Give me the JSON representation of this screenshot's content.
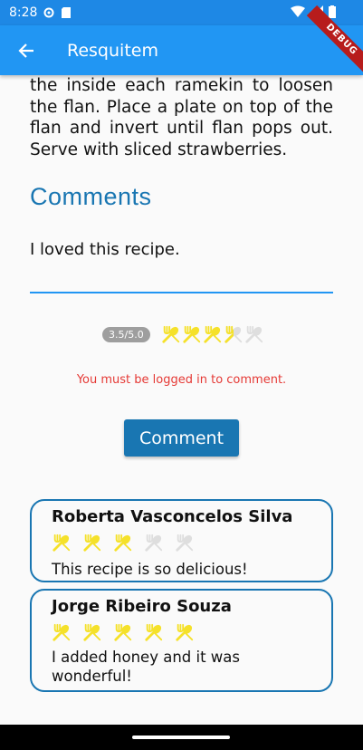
{
  "status_bar": {
    "time": "8:28",
    "icons": [
      "settings-icon",
      "sd-card-icon",
      "wifi-icon",
      "signal-icon",
      "battery-icon"
    ]
  },
  "app_bar": {
    "title": "Resquitem",
    "back_icon": "arrow-back-icon",
    "debug_banner": "DEBUG"
  },
  "recipe": {
    "instructions_tail": "the inside each ramekin to loosen the flan. Place a plate on top of the flan and invert until flan pops out. Serve with sliced strawberries."
  },
  "comments_section": {
    "title": "Comments",
    "input_value": "I loved this recipe.",
    "rating_label": "3.5/5.0",
    "rating_value": 3.5,
    "rating_max": 5,
    "error_message": "You must be logged in to comment.",
    "submit_label": "Comment"
  },
  "comments": [
    {
      "author": "Roberta Vasconcelos Silva",
      "rating": 3,
      "text": "This recipe is so delicious!"
    },
    {
      "author": "Jorge Ribeiro Souza",
      "rating": 5,
      "text": "I added honey and it was wonderful!"
    }
  ],
  "colors": {
    "status_bar": "#1e88e5",
    "app_bar": "#2196f3",
    "accent": "#1976b2",
    "star_active": "#f5e12a",
    "star_inactive": "#dedede",
    "error": "#e53935"
  }
}
